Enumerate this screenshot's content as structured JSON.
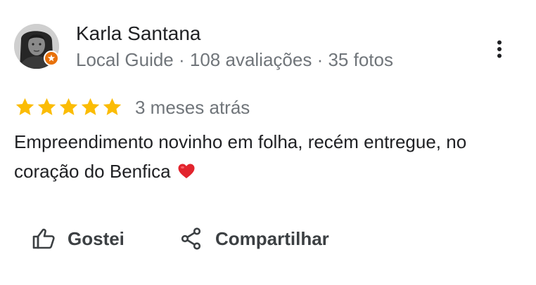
{
  "review": {
    "author": {
      "name": "Karla Santana",
      "local_guide_label": "Local Guide",
      "reviews_count": "108 avaliações",
      "photos_count": "35 fotos",
      "separator": " · "
    },
    "rating": 5,
    "rating_max": 5,
    "time_ago": "3 meses atrás",
    "text": "Empreendimento novinho em folha, recém entregue, no coração do Benfica",
    "emoji": "heart-emoji"
  },
  "actions": {
    "like_label": "Gostei",
    "share_label": "Compartilhar"
  },
  "icons": {
    "more": "more-vert-icon",
    "like": "thumb-up-icon",
    "share": "share-icon",
    "badge": "local-guide-badge-icon",
    "star": "star-icon"
  },
  "colors": {
    "star": "#fbbc04",
    "badge": "#e8710a",
    "secondary_text": "#70757a",
    "primary_text": "#202124",
    "heart": "#e2242d"
  }
}
